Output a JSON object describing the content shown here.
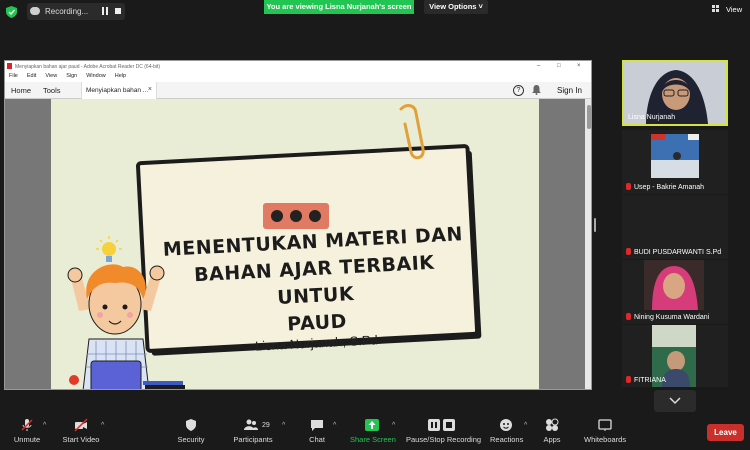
{
  "top": {
    "recording_label": "Recording...",
    "viewing_banner": "You are viewing Lisna Nurjanah's screen",
    "view_options": "View Options ˅",
    "view_button": "View"
  },
  "acrobat": {
    "title": "Menyiapkan bahan ajar paud - Adobe Acrobat Reader DC (64-bit)",
    "menu": [
      "File",
      "Edit",
      "View",
      "Sign",
      "Window",
      "Help"
    ],
    "tab_home": "Home",
    "tab_tools": "Tools",
    "tab_doc": "Menyiapkan bahan ...",
    "tab_doc_close": "×",
    "help": "?",
    "signin": "Sign In",
    "window_controls": [
      "–",
      "□",
      "×"
    ]
  },
  "slide": {
    "title_line1": "MENENTUKAN MATERI DAN",
    "title_line2": "BAHAN AJAR TERBAIK UNTUK",
    "title_line3": "PAUD",
    "author": "Lisna Nurjanah, S.Pd"
  },
  "participants": [
    {
      "name": "Lisna Nurjanah",
      "muted": false
    },
    {
      "name": "Usep - Bakrie Amanah",
      "muted": true
    },
    {
      "name": "BUDI PUSDARWANTI S.Pd",
      "muted": true
    },
    {
      "name": "Nining Kusuma Wardani",
      "muted": true
    },
    {
      "name": "FITRIANA",
      "muted": true
    }
  ],
  "toolbar": {
    "unmute": "Unmute",
    "start_video": "Start Video",
    "security": "Security",
    "participants": "Participants",
    "participants_count": "29",
    "chat": "Chat",
    "share_screen": "Share Screen",
    "pause_recording": "Pause/Stop Recording",
    "reactions": "Reactions",
    "apps": "Apps",
    "whiteboards": "Whiteboards",
    "leave": "Leave"
  },
  "colors": {
    "zoom_green": "#23c552",
    "share_green": "#23c552",
    "leave_red": "#c9302c",
    "active_speaker": "#d4e43a",
    "slide_bg": "#eaedd6",
    "card_bg": "#f6f1dc",
    "dots_bg": "#e07a62"
  }
}
